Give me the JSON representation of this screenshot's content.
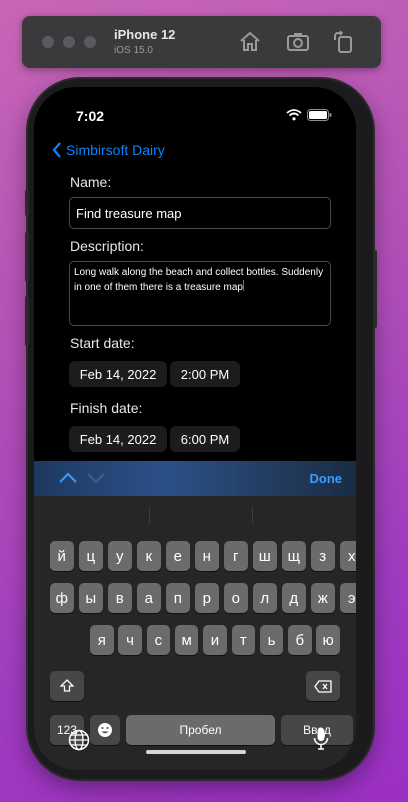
{
  "simulator": {
    "device_name": "iPhone 12",
    "os_version": "iOS 15.0",
    "icons": [
      "home-icon",
      "screenshot-icon",
      "rotate-icon"
    ]
  },
  "status_bar": {
    "time": "7:02"
  },
  "nav": {
    "back_label": "Simbirsoft Dairy"
  },
  "form": {
    "name_label": "Name:",
    "name_value": "Find treasure map",
    "description_label": "Description:",
    "description_value": "Long walk along the beach and collect bottles. Suddenly in one of them there is a treasure map",
    "start_label": "Start date:",
    "start_date": "Feb 14, 2022",
    "start_time": "2:00 PM",
    "finish_label": "Finish date:",
    "finish_date": "Feb 14, 2022",
    "finish_time": "6:00 PM"
  },
  "keyboard": {
    "done_label": "Done",
    "row1": [
      "й",
      "ц",
      "у",
      "к",
      "е",
      "н",
      "г",
      "ш",
      "щ",
      "з",
      "х"
    ],
    "row2": [
      "ф",
      "ы",
      "в",
      "а",
      "п",
      "р",
      "о",
      "л",
      "д",
      "ж",
      "э"
    ],
    "row3": [
      "я",
      "ч",
      "с",
      "м",
      "и",
      "т",
      "ь",
      "б",
      "ю"
    ],
    "numbers_label": "123",
    "space_label": "Пробел",
    "return_label": "Ввод"
  },
  "colors": {
    "accent": "#0a84ff",
    "background": "#000000"
  }
}
